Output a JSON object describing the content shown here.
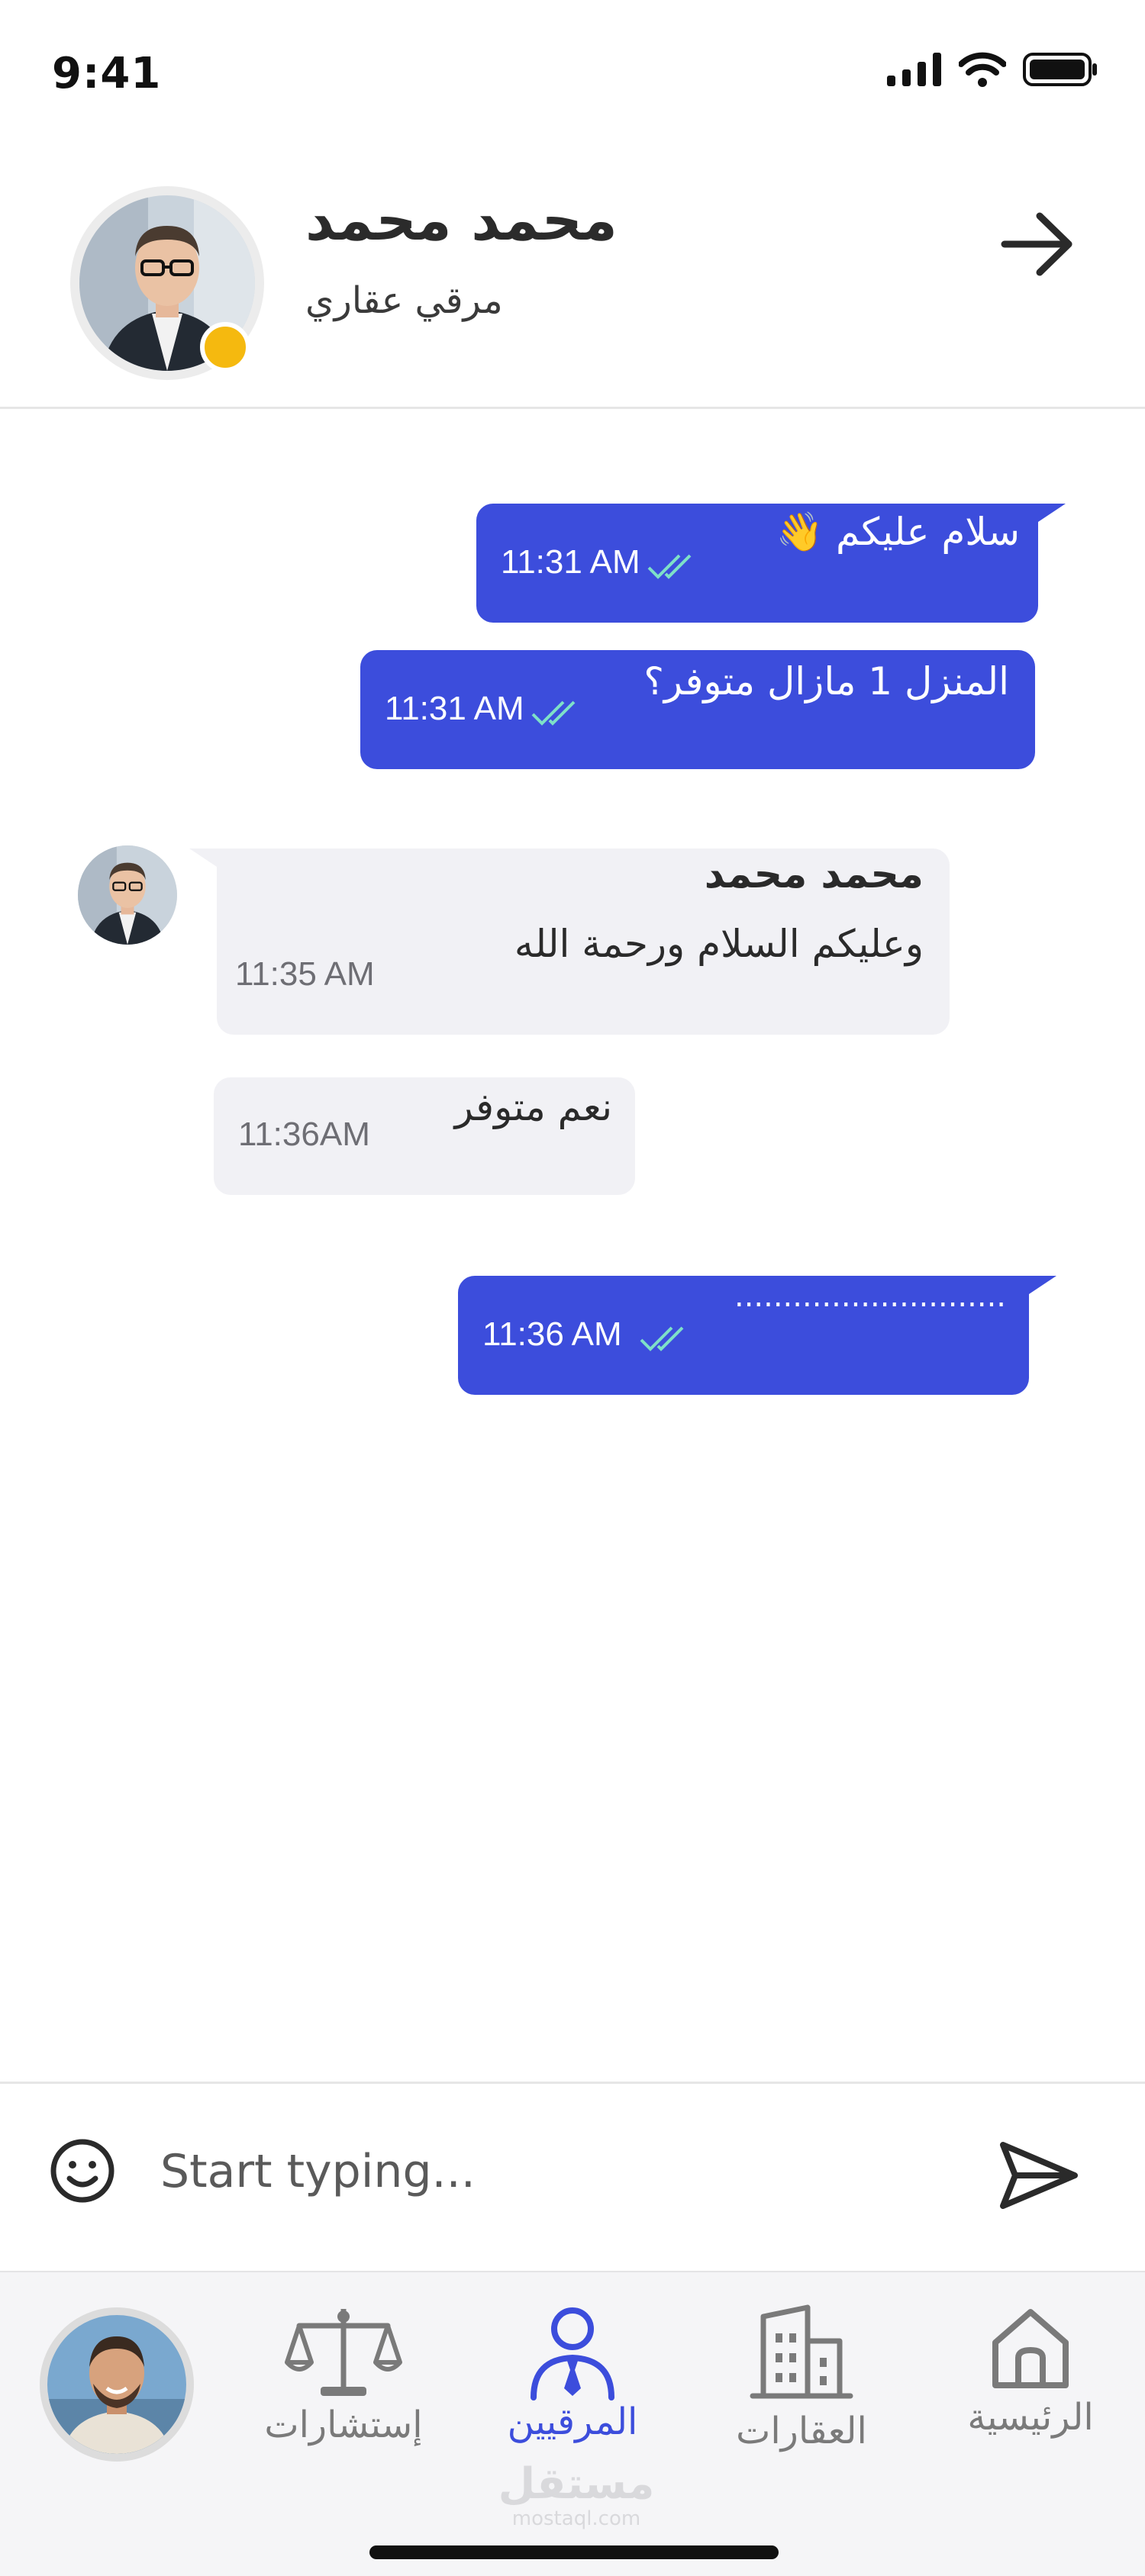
{
  "status_bar": {
    "time": "9:41"
  },
  "header": {
    "contact_name": "محمد محمد",
    "contact_role": "مرقي عقاري"
  },
  "messages": [
    {
      "direction": "outgoing",
      "text": "سلام عليكم 👋",
      "time": "11:31 AM"
    },
    {
      "direction": "outgoing",
      "text": "المنزل 1 مازال متوفر؟",
      "time": "11:31 AM"
    },
    {
      "direction": "incoming",
      "sender": "محمد محمد",
      "text": "وعليكم السلام ورحمة الله",
      "time": "11:35 AM"
    },
    {
      "direction": "incoming",
      "text": "نعم متوفر",
      "time": "11:36AM"
    },
    {
      "direction": "outgoing",
      "text": "............................",
      "time": "11:36 AM"
    }
  ],
  "composer": {
    "placeholder": "Start typing..."
  },
  "bottom_nav": {
    "items": [
      {
        "label": "إستشارات",
        "icon": "scale-icon"
      },
      {
        "label": "المرقيين",
        "icon": "user-tie-icon",
        "active": true
      },
      {
        "label": "العقارات",
        "icon": "buildings-icon"
      },
      {
        "label": "الرئيسية",
        "icon": "home-icon"
      }
    ]
  },
  "watermark": {
    "arabic": "مستقل",
    "latin": "mostaql.com"
  },
  "colors": {
    "accent": "#3c4ddc",
    "incoming_bubble": "#f1f1f5",
    "online_dot": "#f5b90f",
    "ticks": "#7ee0c8"
  }
}
